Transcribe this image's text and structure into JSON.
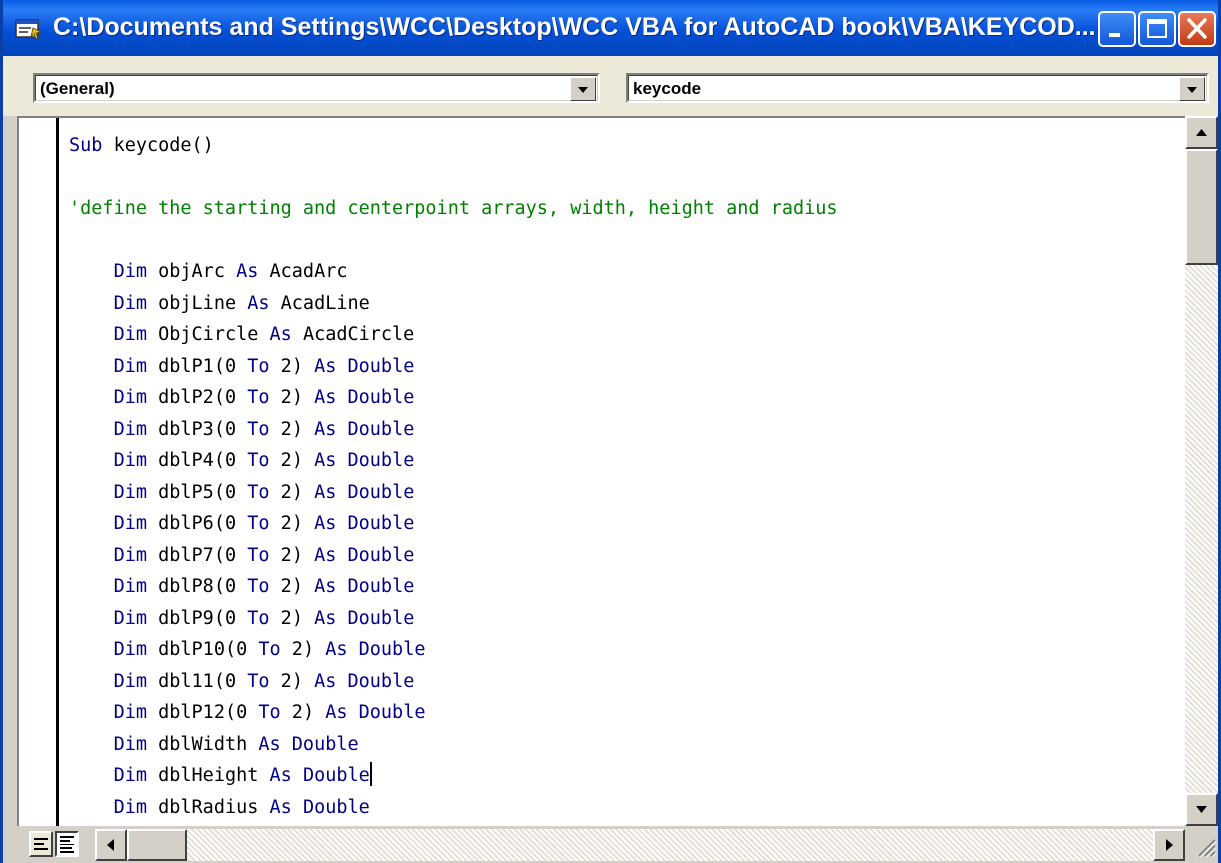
{
  "window": {
    "title": "C:\\Documents and Settings\\WCC\\Desktop\\WCC VBA for AutoCAD book\\VBA\\KEYCOD...",
    "icons": {
      "app": "vba-module-icon",
      "minimize": "minimize-icon",
      "maximize": "maximize-icon",
      "close": "close-icon"
    }
  },
  "object_combo": {
    "value": "(General)"
  },
  "procedure_combo": {
    "value": "keycode"
  },
  "code": {
    "lines": [
      "Sub keycode()",
      "",
      "'define the starting and centerpoint arrays, width, height and radius",
      "",
      "    Dim objArc As AcadArc",
      "    Dim objLine As AcadLine",
      "    Dim ObjCircle As AcadCircle",
      "    Dim dblP1(0 To 2) As Double",
      "    Dim dblP2(0 To 2) As Double",
      "    Dim dblP3(0 To 2) As Double",
      "    Dim dblP4(0 To 2) As Double",
      "    Dim dblP5(0 To 2) As Double",
      "    Dim dblP6(0 To 2) As Double",
      "    Dim dblP7(0 To 2) As Double",
      "    Dim dblP8(0 To 2) As Double",
      "    Dim dblP9(0 To 2) As Double",
      "    Dim dblP10(0 To 2) As Double",
      "    Dim dbl11(0 To 2) As Double",
      "    Dim dblP12(0 To 2) As Double",
      "    Dim dblWidth As Double",
      "    Dim dblHeight As Double",
      "    Dim dblRadius As Double"
    ],
    "keywords": [
      "Sub",
      "Dim",
      "As",
      "To",
      "Double"
    ],
    "caret_line": 20,
    "colors": {
      "keyword": "#00008b",
      "comment": "#008000",
      "text": "#000000"
    }
  },
  "statusbar": {
    "icons": {
      "procedure_view": "procedure-view-icon",
      "full_module_view": "full-module-view-icon"
    }
  }
}
